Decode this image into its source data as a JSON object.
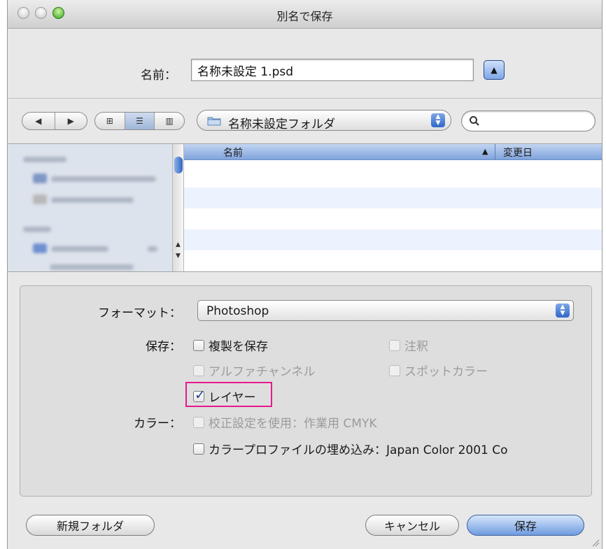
{
  "window": {
    "title": "別名で保存"
  },
  "name_row": {
    "label": "名前：",
    "value": "名称未設定 1.psd"
  },
  "toolbar": {
    "back_glyph": "◀",
    "forward_glyph": "▶",
    "view_icon_glyph": "⊞",
    "view_list_glyph": "☰",
    "view_column_glyph": "▥",
    "folder_name": "名称未設定フォルダ",
    "search_placeholder": ""
  },
  "file_browser": {
    "columns": [
      "名前",
      "変更日"
    ],
    "sort_arrow": "▲",
    "rows": []
  },
  "options": {
    "format_label": "フォーマット：",
    "format_value": "Photoshop",
    "save_label": "保存：",
    "color_label": "カラー：",
    "checkboxes": {
      "duplicate": "複製を保存",
      "notes": "注釈",
      "alpha": "アルファチャンネル",
      "spot": "スポットカラー",
      "layers": "レイヤー",
      "proof": "校正設定を使用：作業用 CMYK",
      "icc": "カラープロファイルの埋め込み：Japan Color 2001 Co"
    }
  },
  "buttons": {
    "new_folder": "新規フォルダ",
    "cancel": "キャンセル",
    "save": "保存"
  },
  "colors": {
    "accent": "#6f9ce0",
    "highlight": "#e6198d"
  }
}
